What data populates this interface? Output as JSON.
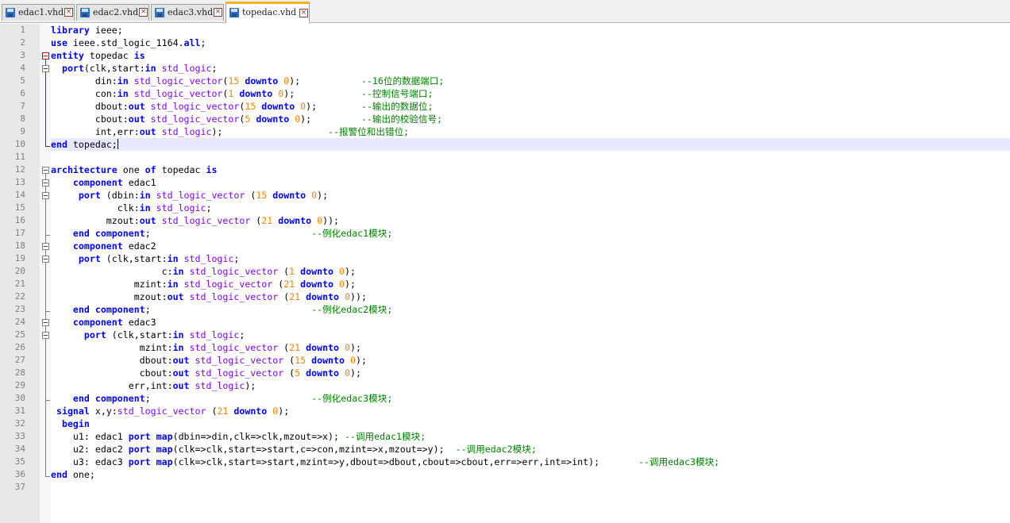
{
  "tabs": [
    {
      "label": "edac1.vhd",
      "active": false
    },
    {
      "label": "edac2.vhd",
      "active": false
    },
    {
      "label": "edac3.vhd",
      "active": false
    },
    {
      "label": "topedac.vhd",
      "active": true
    }
  ],
  "tab_close_glyph": "×",
  "colors": {
    "keyword": "#0000ff",
    "type": "#8000ff",
    "number": "#ff8000",
    "comment": "#008000",
    "current_line": "#e8e8ff",
    "active_tab_accent": "#fab020"
  },
  "current_line": 10,
  "lines": [
    [
      {
        "t": "library",
        "c": "kw"
      },
      {
        "t": " ieee;"
      }
    ],
    [
      {
        "t": "use",
        "c": "kw"
      },
      {
        "t": " ieee.std_logic_1164."
      },
      {
        "t": "all",
        "c": "kw"
      },
      {
        "t": ";"
      }
    ],
    [
      {
        "t": "entity",
        "c": "kw"
      },
      {
        "t": " topedac "
      },
      {
        "t": "is",
        "c": "kw"
      }
    ],
    [
      {
        "t": "  "
      },
      {
        "t": "port",
        "c": "kw"
      },
      {
        "t": "(clk,start:"
      },
      {
        "t": "in",
        "c": "kw"
      },
      {
        "t": " "
      },
      {
        "t": "std_logic",
        "c": "ty"
      },
      {
        "t": ";"
      }
    ],
    [
      {
        "t": "        din:"
      },
      {
        "t": "in",
        "c": "kw"
      },
      {
        "t": " "
      },
      {
        "t": "std_logic_vector",
        "c": "ty"
      },
      {
        "t": "("
      },
      {
        "t": "15",
        "c": "nm"
      },
      {
        "t": " "
      },
      {
        "t": "downto",
        "c": "kw"
      },
      {
        "t": " "
      },
      {
        "t": "0",
        "c": "nm"
      },
      {
        "t": ");           "
      },
      {
        "t": "--16位的数据端口;",
        "c": "cm"
      }
    ],
    [
      {
        "t": "        con:"
      },
      {
        "t": "in",
        "c": "kw"
      },
      {
        "t": " "
      },
      {
        "t": "std_logic_vector",
        "c": "ty"
      },
      {
        "t": "("
      },
      {
        "t": "1",
        "c": "nm"
      },
      {
        "t": " "
      },
      {
        "t": "downto",
        "c": "kw"
      },
      {
        "t": " "
      },
      {
        "t": "0",
        "c": "nm"
      },
      {
        "t": ");            "
      },
      {
        "t": "--控制信号端口;",
        "c": "cm"
      }
    ],
    [
      {
        "t": "        dbout:"
      },
      {
        "t": "out",
        "c": "kw"
      },
      {
        "t": " "
      },
      {
        "t": "std_logic_vector",
        "c": "ty"
      },
      {
        "t": "("
      },
      {
        "t": "15",
        "c": "nm"
      },
      {
        "t": " "
      },
      {
        "t": "downto",
        "c": "kw"
      },
      {
        "t": " "
      },
      {
        "t": "0",
        "c": "nm"
      },
      {
        "t": ");        "
      },
      {
        "t": "--输出的数据位;",
        "c": "cm"
      }
    ],
    [
      {
        "t": "        cbout:"
      },
      {
        "t": "out",
        "c": "kw"
      },
      {
        "t": " "
      },
      {
        "t": "std_logic_vector",
        "c": "ty"
      },
      {
        "t": "("
      },
      {
        "t": "5",
        "c": "nm"
      },
      {
        "t": " "
      },
      {
        "t": "downto",
        "c": "kw"
      },
      {
        "t": " "
      },
      {
        "t": "0",
        "c": "nm"
      },
      {
        "t": ");         "
      },
      {
        "t": "--输出的校验信号;",
        "c": "cm"
      }
    ],
    [
      {
        "t": "        int,err:"
      },
      {
        "t": "out",
        "c": "kw"
      },
      {
        "t": " "
      },
      {
        "t": "std_logic",
        "c": "ty"
      },
      {
        "t": ");                   "
      },
      {
        "t": "--报警位和出错位;",
        "c": "cm"
      }
    ],
    [
      {
        "t": "end",
        "c": "kw"
      },
      {
        "t": " topedac;"
      }
    ],
    [],
    [
      {
        "t": "architecture",
        "c": "kw"
      },
      {
        "t": " one "
      },
      {
        "t": "of",
        "c": "kw"
      },
      {
        "t": " topedac "
      },
      {
        "t": "is",
        "c": "kw"
      }
    ],
    [
      {
        "t": "    "
      },
      {
        "t": "component",
        "c": "kw"
      },
      {
        "t": " edac1"
      }
    ],
    [
      {
        "t": "     "
      },
      {
        "t": "port",
        "c": "kw"
      },
      {
        "t": " (dbin:"
      },
      {
        "t": "in",
        "c": "kw"
      },
      {
        "t": " "
      },
      {
        "t": "std_logic_vector",
        "c": "ty"
      },
      {
        "t": " ("
      },
      {
        "t": "15",
        "c": "nm"
      },
      {
        "t": " "
      },
      {
        "t": "downto",
        "c": "kw"
      },
      {
        "t": " "
      },
      {
        "t": "0",
        "c": "nm"
      },
      {
        "t": ");"
      }
    ],
    [
      {
        "t": "            clk:"
      },
      {
        "t": "in",
        "c": "kw"
      },
      {
        "t": " "
      },
      {
        "t": "std_logic",
        "c": "ty"
      },
      {
        "t": ";"
      }
    ],
    [
      {
        "t": "          mzout:"
      },
      {
        "t": "out",
        "c": "kw"
      },
      {
        "t": " "
      },
      {
        "t": "std_logic_vector",
        "c": "ty"
      },
      {
        "t": " ("
      },
      {
        "t": "21",
        "c": "nm"
      },
      {
        "t": " "
      },
      {
        "t": "downto",
        "c": "kw"
      },
      {
        "t": " "
      },
      {
        "t": "0",
        "c": "nm"
      },
      {
        "t": "));"
      }
    ],
    [
      {
        "t": "    "
      },
      {
        "t": "end",
        "c": "kw"
      },
      {
        "t": " "
      },
      {
        "t": "component",
        "c": "kw"
      },
      {
        "t": ";                             "
      },
      {
        "t": "--例化edac1模块;",
        "c": "cm"
      }
    ],
    [
      {
        "t": "    "
      },
      {
        "t": "component",
        "c": "kw"
      },
      {
        "t": " edac2"
      }
    ],
    [
      {
        "t": "     "
      },
      {
        "t": "port",
        "c": "kw"
      },
      {
        "t": " (clk,start:"
      },
      {
        "t": "in",
        "c": "kw"
      },
      {
        "t": " "
      },
      {
        "t": "std_logic",
        "c": "ty"
      },
      {
        "t": ";"
      }
    ],
    [
      {
        "t": "                    c:"
      },
      {
        "t": "in",
        "c": "kw"
      },
      {
        "t": " "
      },
      {
        "t": "std_logic_vector",
        "c": "ty"
      },
      {
        "t": " ("
      },
      {
        "t": "1",
        "c": "nm"
      },
      {
        "t": " "
      },
      {
        "t": "downto",
        "c": "kw"
      },
      {
        "t": " "
      },
      {
        "t": "0",
        "c": "nm"
      },
      {
        "t": ");"
      }
    ],
    [
      {
        "t": "               mzint:"
      },
      {
        "t": "in",
        "c": "kw"
      },
      {
        "t": " "
      },
      {
        "t": "std_logic_vector",
        "c": "ty"
      },
      {
        "t": " ("
      },
      {
        "t": "21",
        "c": "nm"
      },
      {
        "t": " "
      },
      {
        "t": "downto",
        "c": "kw"
      },
      {
        "t": " "
      },
      {
        "t": "0",
        "c": "nm"
      },
      {
        "t": ");"
      }
    ],
    [
      {
        "t": "               mzout:"
      },
      {
        "t": "out",
        "c": "kw"
      },
      {
        "t": " "
      },
      {
        "t": "std_logic_vector",
        "c": "ty"
      },
      {
        "t": " ("
      },
      {
        "t": "21",
        "c": "nm"
      },
      {
        "t": " "
      },
      {
        "t": "downto",
        "c": "kw"
      },
      {
        "t": " "
      },
      {
        "t": "0",
        "c": "nm"
      },
      {
        "t": "));"
      }
    ],
    [
      {
        "t": "    "
      },
      {
        "t": "end",
        "c": "kw"
      },
      {
        "t": " "
      },
      {
        "t": "component",
        "c": "kw"
      },
      {
        "t": ";                             "
      },
      {
        "t": "--例化edac2模块;",
        "c": "cm"
      }
    ],
    [
      {
        "t": "    "
      },
      {
        "t": "component",
        "c": "kw"
      },
      {
        "t": " edac3"
      }
    ],
    [
      {
        "t": "      "
      },
      {
        "t": "port",
        "c": "kw"
      },
      {
        "t": " (clk,start:"
      },
      {
        "t": "in",
        "c": "kw"
      },
      {
        "t": " "
      },
      {
        "t": "std_logic",
        "c": "ty"
      },
      {
        "t": ";"
      }
    ],
    [
      {
        "t": "                mzint:"
      },
      {
        "t": "in",
        "c": "kw"
      },
      {
        "t": " "
      },
      {
        "t": "std_logic_vector",
        "c": "ty"
      },
      {
        "t": " ("
      },
      {
        "t": "21",
        "c": "nm"
      },
      {
        "t": " "
      },
      {
        "t": "downto",
        "c": "kw"
      },
      {
        "t": " "
      },
      {
        "t": "0",
        "c": "nm"
      },
      {
        "t": ");"
      }
    ],
    [
      {
        "t": "                dbout:"
      },
      {
        "t": "out",
        "c": "kw"
      },
      {
        "t": " "
      },
      {
        "t": "std_logic_vector",
        "c": "ty"
      },
      {
        "t": " ("
      },
      {
        "t": "15",
        "c": "nm"
      },
      {
        "t": " "
      },
      {
        "t": "downto",
        "c": "kw"
      },
      {
        "t": " "
      },
      {
        "t": "0",
        "c": "nm"
      },
      {
        "t": ");"
      }
    ],
    [
      {
        "t": "                cbout:"
      },
      {
        "t": "out",
        "c": "kw"
      },
      {
        "t": " "
      },
      {
        "t": "std_logic_vector",
        "c": "ty"
      },
      {
        "t": " ("
      },
      {
        "t": "5",
        "c": "nm"
      },
      {
        "t": " "
      },
      {
        "t": "downto",
        "c": "kw"
      },
      {
        "t": " "
      },
      {
        "t": "0",
        "c": "nm"
      },
      {
        "t": ");"
      }
    ],
    [
      {
        "t": "              err,int:"
      },
      {
        "t": "out",
        "c": "kw"
      },
      {
        "t": " "
      },
      {
        "t": "std_logic",
        "c": "ty"
      },
      {
        "t": ");"
      }
    ],
    [
      {
        "t": "    "
      },
      {
        "t": "end",
        "c": "kw"
      },
      {
        "t": " "
      },
      {
        "t": "component",
        "c": "kw"
      },
      {
        "t": ";                             "
      },
      {
        "t": "--例化edac3模块;",
        "c": "cm"
      }
    ],
    [
      {
        "t": " "
      },
      {
        "t": "signal",
        "c": "kw"
      },
      {
        "t": " x,y:"
      },
      {
        "t": "std_logic_vector",
        "c": "ty"
      },
      {
        "t": " ("
      },
      {
        "t": "21",
        "c": "nm"
      },
      {
        "t": " "
      },
      {
        "t": "downto",
        "c": "kw"
      },
      {
        "t": " "
      },
      {
        "t": "0",
        "c": "nm"
      },
      {
        "t": ");"
      }
    ],
    [
      {
        "t": "  "
      },
      {
        "t": "begin",
        "c": "kw"
      }
    ],
    [
      {
        "t": "    u1: edac1 "
      },
      {
        "t": "port",
        "c": "kw"
      },
      {
        "t": " "
      },
      {
        "t": "map",
        "c": "kw"
      },
      {
        "t": "(dbin=>din,clk=>clk,mzout=>x); "
      },
      {
        "t": "--调用edac1模块;",
        "c": "cm"
      }
    ],
    [
      {
        "t": "    u2: edac2 "
      },
      {
        "t": "port",
        "c": "kw"
      },
      {
        "t": " "
      },
      {
        "t": "map",
        "c": "kw"
      },
      {
        "t": "(clk=>clk,start=>start,c=>con,mzint=>x,mzout=>y);  "
      },
      {
        "t": "--调用edac2模块;",
        "c": "cm"
      }
    ],
    [
      {
        "t": "    u3: edac3 "
      },
      {
        "t": "port",
        "c": "kw"
      },
      {
        "t": " "
      },
      {
        "t": "map",
        "c": "kw"
      },
      {
        "t": "(clk=>clk,start=>start,mzint=>y,dbout=>dbout,cbout=>cbout,err=>err,int=>int);       "
      },
      {
        "t": "--调用edac3模块;",
        "c": "cm"
      }
    ],
    [
      {
        "t": "end",
        "c": "kw"
      },
      {
        "t": " one;"
      }
    ],
    []
  ]
}
